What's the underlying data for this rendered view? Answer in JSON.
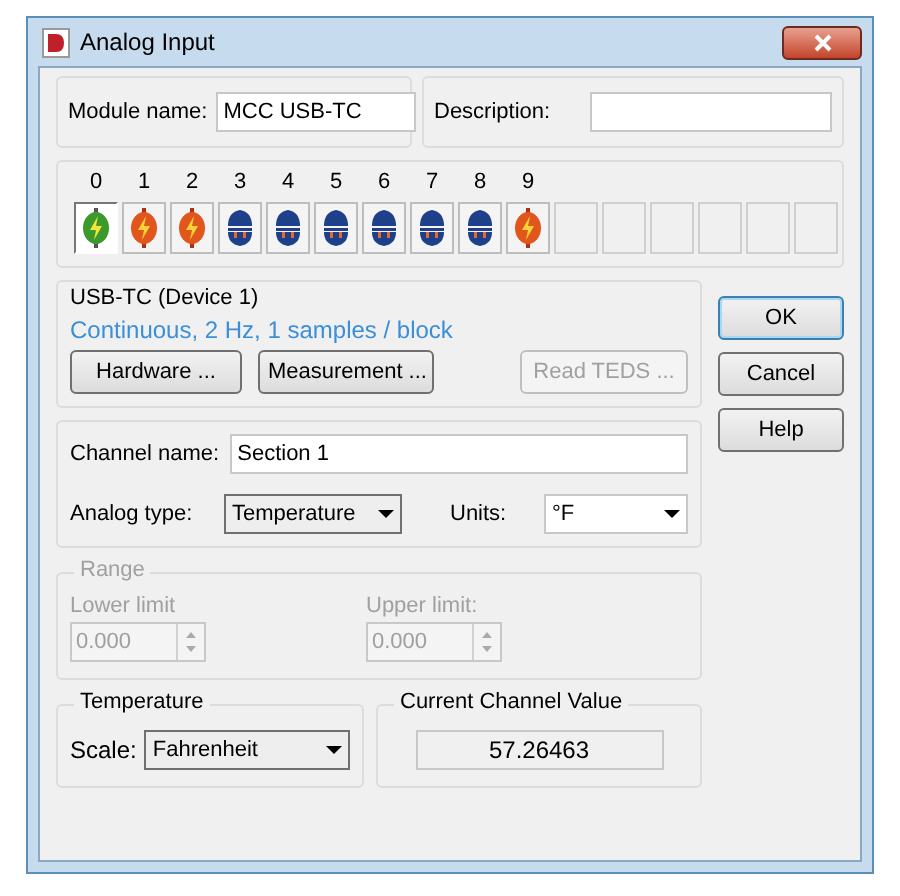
{
  "window": {
    "title": "Analog Input"
  },
  "module": {
    "label": "Module name:",
    "value": "MCC USB-TC"
  },
  "description": {
    "label": "Description:"
  },
  "channels": [
    {
      "label": "0",
      "kind": "active",
      "selected": true
    },
    {
      "label": "1",
      "kind": "error",
      "selected": false
    },
    {
      "label": "2",
      "kind": "error",
      "selected": false
    },
    {
      "label": "3",
      "kind": "unplugged",
      "selected": false
    },
    {
      "label": "4",
      "kind": "unplugged",
      "selected": false
    },
    {
      "label": "5",
      "kind": "unplugged",
      "selected": false
    },
    {
      "label": "6",
      "kind": "unplugged",
      "selected": false
    },
    {
      "label": "7",
      "kind": "unplugged",
      "selected": false
    },
    {
      "label": "8",
      "kind": "unplugged",
      "selected": false
    },
    {
      "label": "9",
      "kind": "error",
      "selected": false
    },
    {
      "kind": "empty",
      "selected": false
    },
    {
      "kind": "empty",
      "selected": false
    },
    {
      "kind": "empty",
      "selected": false
    },
    {
      "kind": "empty",
      "selected": false
    },
    {
      "kind": "empty",
      "selected": false
    },
    {
      "kind": "empty",
      "selected": false
    }
  ],
  "device": {
    "title": "USB-TC (Device 1)",
    "info": "Continuous, 2 Hz, 1 samples / block",
    "buttons": [
      {
        "label": "Hardware ...",
        "disabled": false
      },
      {
        "label": "Measurement ...",
        "disabled": false
      },
      {
        "label": "Read TEDS ...",
        "disabled": true
      }
    ]
  },
  "dialog_buttons": [
    {
      "label": "OK",
      "default": true
    },
    {
      "label": "Cancel",
      "default": false
    },
    {
      "label": "Help",
      "default": false
    }
  ],
  "channel": {
    "name_label": "Channel name:",
    "name": "Section 1",
    "type_label": "Analog type:",
    "type": "Temperature",
    "units_label": "Units:",
    "units": "°F"
  },
  "range": {
    "title": "Range",
    "disabled": true,
    "lower_label": "Lower limit",
    "lower": "0.000",
    "upper_label": "Upper limit:",
    "upper": "0.000"
  },
  "temperature": {
    "title": "Temperature",
    "scale_label": "Scale:",
    "scale": "Fahrenheit"
  },
  "current": {
    "title": "Current Channel Value",
    "value": "57.26463"
  }
}
